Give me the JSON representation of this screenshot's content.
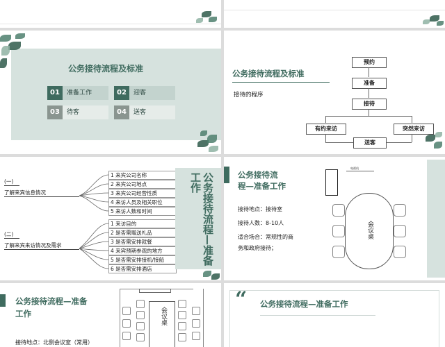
{
  "slide2": {
    "title": "公务接待流程及标准",
    "items": [
      {
        "num": "01",
        "label": "准备工作"
      },
      {
        "num": "02",
        "label": "迎客"
      },
      {
        "num": "03",
        "label": "待客"
      },
      {
        "num": "04",
        "label": "送客"
      }
    ]
  },
  "slide3": {
    "title": "公务接待流程及标准",
    "subtitle": "接待的程序",
    "flow": {
      "step1": "预约",
      "step2": "准备",
      "step3": "接待",
      "left": "有约来访",
      "right": "突然来访",
      "end": "送客"
    }
  },
  "slide4": {
    "group1_label": "(一)",
    "group1_title": "了解来宾信息情况",
    "group1_items": [
      "1 来宾公司名称",
      "2 来宾公司地点",
      "3 来宾公司经营性质",
      "4 来访人员及相关职位",
      "5 来访人数和时间"
    ],
    "group2_label": "(二)",
    "group2_title": "了解来宾来访情况及需求",
    "group2_items": [
      "1 来访目的",
      "2 是否需赠送礼品",
      "3 是否需安排就餐",
      "4 来宾预期参观的地方",
      "5 是否需安排接机/接船",
      "6 是否需安排酒店"
    ],
    "side_title": "公务接待流程—准备工作"
  },
  "slide5": {
    "title_line1": "公务接待流",
    "title_line2": "程—准备工作",
    "lines": [
      "接待地点：接待室",
      "接待人数：8-10人",
      "适合场合：常规性的商",
      "务和政府接待；"
    ],
    "table_label": "会议桌",
    "tv_label": "电视机"
  },
  "slide6": {
    "title_line1": "公务接待流程—准备",
    "title_line2": "工作",
    "line1": "接待地点：北侧会议室（常用）",
    "table_label": "会议桌"
  },
  "slide7": {
    "quote": "“",
    "title": "公务接待流程—准备工作"
  }
}
